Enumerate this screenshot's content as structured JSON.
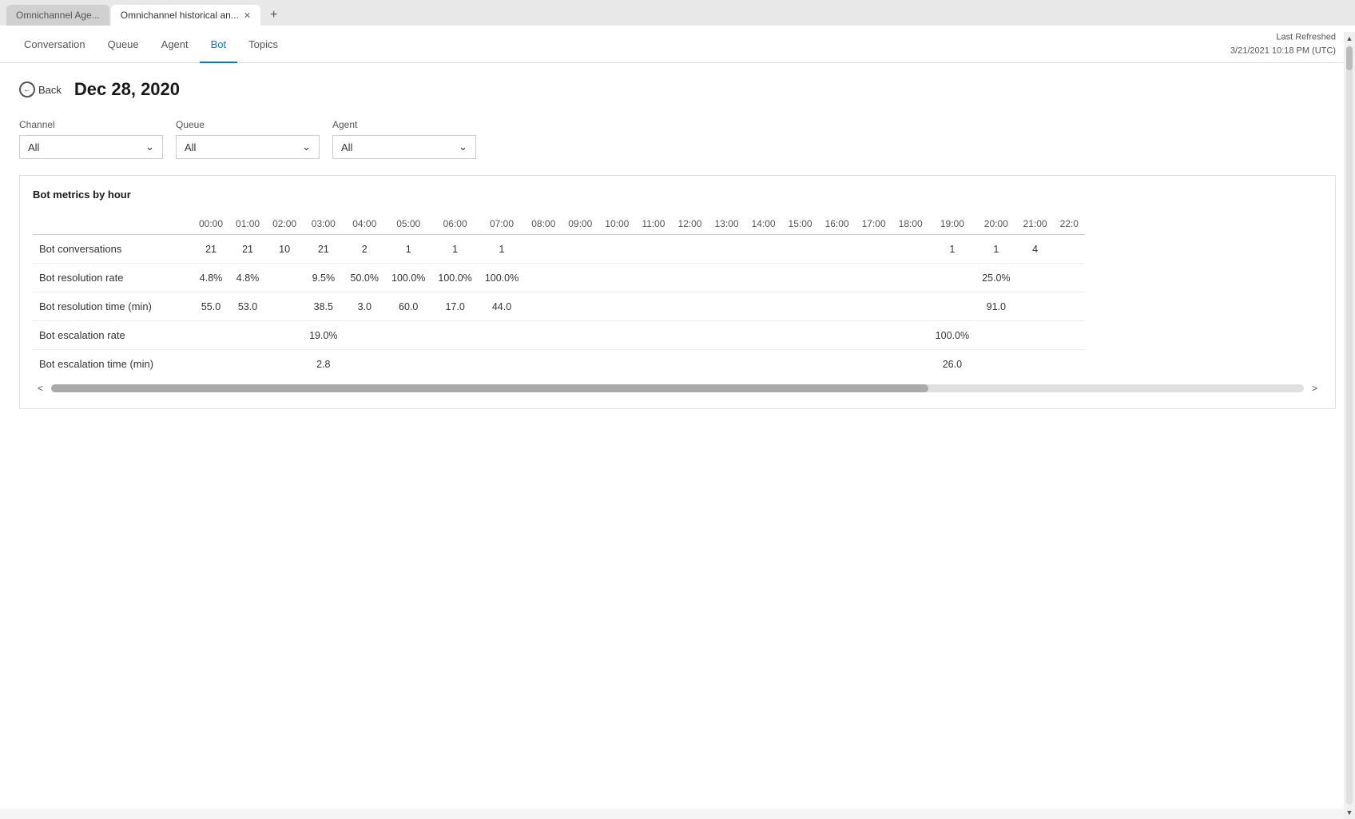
{
  "browser": {
    "tabs": [
      {
        "id": "tab1",
        "label": "Omnichannel Age...",
        "active": false,
        "closeable": false
      },
      {
        "id": "tab2",
        "label": "Omnichannel historical an...",
        "active": true,
        "closeable": true
      }
    ],
    "new_tab_label": "+"
  },
  "header": {
    "last_refreshed_label": "Last Refreshed",
    "last_refreshed_value": "3/21/2021 10:18 PM (UTC)"
  },
  "nav": {
    "items": [
      {
        "id": "conversation",
        "label": "Conversation",
        "active": false
      },
      {
        "id": "queue",
        "label": "Queue",
        "active": false
      },
      {
        "id": "agent",
        "label": "Agent",
        "active": false
      },
      {
        "id": "bot",
        "label": "Bot",
        "active": true
      },
      {
        "id": "topics",
        "label": "Topics",
        "active": false
      }
    ]
  },
  "page": {
    "back_label": "Back",
    "date": "Dec 28, 2020"
  },
  "filters": {
    "channel": {
      "label": "Channel",
      "value": "All"
    },
    "queue": {
      "label": "Queue",
      "value": "All"
    },
    "agent": {
      "label": "Agent",
      "value": "All"
    }
  },
  "metrics_table": {
    "title": "Bot metrics by hour",
    "hours": [
      "00:00",
      "01:00",
      "02:00",
      "03:00",
      "04:00",
      "05:00",
      "06:00",
      "07:00",
      "08:00",
      "09:00",
      "10:00",
      "11:00",
      "12:00",
      "13:00",
      "14:00",
      "15:00",
      "16:00",
      "17:00",
      "18:00",
      "19:00",
      "20:00",
      "21:00",
      "22:0"
    ],
    "rows": [
      {
        "label": "Bot conversations",
        "values": [
          "21",
          "21",
          "10",
          "21",
          "2",
          "1",
          "1",
          "1",
          "",
          "",
          "",
          "",
          "",
          "",
          "",
          "",
          "",
          "",
          "",
          "1",
          "1",
          "4",
          ""
        ]
      },
      {
        "label": "Bot resolution rate",
        "values": [
          "4.8%",
          "4.8%",
          "",
          "9.5%",
          "50.0%",
          "100.0%",
          "100.0%",
          "100.0%",
          "",
          "",
          "",
          "",
          "",
          "",
          "",
          "",
          "",
          "",
          "",
          "",
          "25.0%",
          "",
          ""
        ]
      },
      {
        "label": "Bot resolution time (min)",
        "values": [
          "55.0",
          "53.0",
          "",
          "38.5",
          "3.0",
          "60.0",
          "17.0",
          "44.0",
          "",
          "",
          "",
          "",
          "",
          "",
          "",
          "",
          "",
          "",
          "",
          "",
          "91.0",
          "",
          ""
        ]
      },
      {
        "label": "Bot escalation rate",
        "values": [
          "",
          "",
          "",
          "19.0%",
          "",
          "",
          "",
          "",
          "",
          "",
          "",
          "",
          "",
          "",
          "",
          "",
          "",
          "",
          "",
          "100.0%",
          "",
          "",
          ""
        ]
      },
      {
        "label": "Bot escalation time (min)",
        "values": [
          "",
          "",
          "",
          "2.8",
          "",
          "",
          "",
          "",
          "",
          "",
          "",
          "",
          "",
          "",
          "",
          "",
          "",
          "",
          "",
          "26.0",
          "",
          "",
          ""
        ]
      }
    ]
  }
}
